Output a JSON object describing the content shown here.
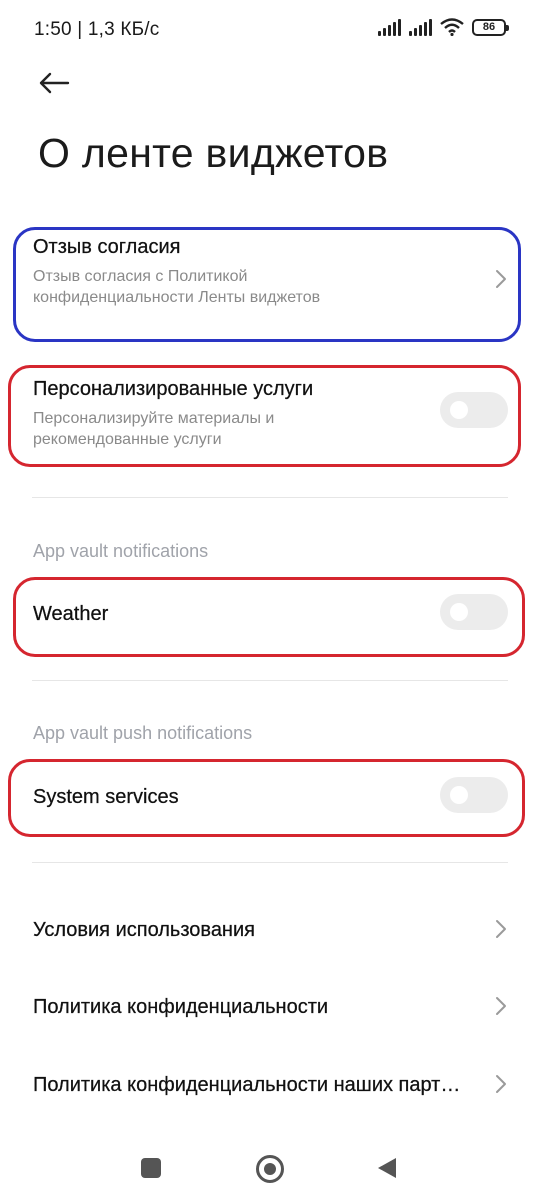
{
  "status_bar": {
    "time_speed": "1:50 | 1,3 КБ/с",
    "battery": "86",
    "icons": [
      "signal-icon",
      "signal-icon",
      "wifi-icon",
      "battery-icon"
    ]
  },
  "header": {
    "back_icon": "arrow-left-icon",
    "title": "О ленте виджетов"
  },
  "items": {
    "consent": {
      "title": "Отзыв согласия",
      "subtitle": "Отзыв согласия с Политикой конфиденциальности Ленты виджетов"
    },
    "personalized": {
      "title": "Персонализированные услуги",
      "subtitle": "Персонализируйте материалы и рекомендованные услуги",
      "enabled": false
    }
  },
  "sections": {
    "app_vault_notifications": {
      "label": "App vault notifications",
      "item_title": "Weather",
      "enabled": false
    },
    "app_vault_push": {
      "label": "App vault push notifications",
      "item_title": "System services",
      "enabled": false
    }
  },
  "links": [
    {
      "label": "Условия использования"
    },
    {
      "label": "Политика конфиденциальности"
    },
    {
      "label": "Политика конфиденциальности наших парт…"
    }
  ],
  "colors": {
    "highlight_blue": "#2a35c4",
    "highlight_red": "#d5262f",
    "toggle_off": "#ececec",
    "secondary_text": "#8a8a8a"
  },
  "nav_bar": {
    "icons": [
      "recents-square-icon",
      "home-circle-icon",
      "back-triangle-icon"
    ]
  }
}
